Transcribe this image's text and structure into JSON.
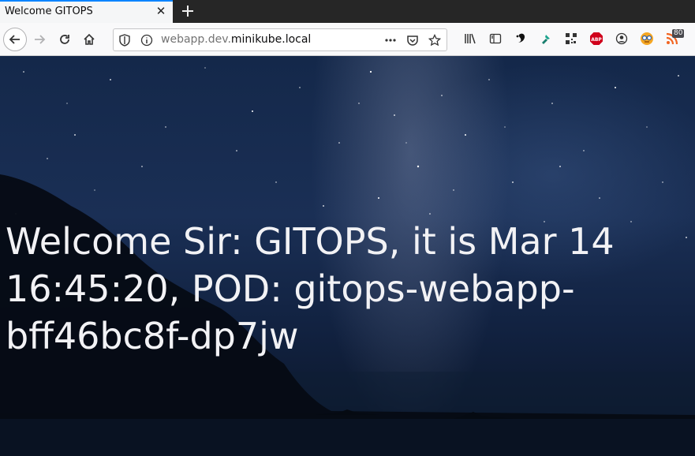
{
  "tab": {
    "title": "Welcome GITOPS",
    "close_icon": "close-icon",
    "new_tab_icon": "plus-icon"
  },
  "nav": {
    "url_host_prefix": "webapp.dev.",
    "url_host_domain": "minikube.local"
  },
  "extensions": {
    "rss_badge": "80"
  },
  "page": {
    "welcome_text": "Welcome Sir: GITOPS, it is Mar 14 16:45:20, POD: gitops-webapp-bff46bc8f-dp7jw"
  },
  "colors": {
    "tab_accent": "#0a84ff",
    "abp_red": "#d0021b",
    "text_light": "#f2f2f5"
  }
}
